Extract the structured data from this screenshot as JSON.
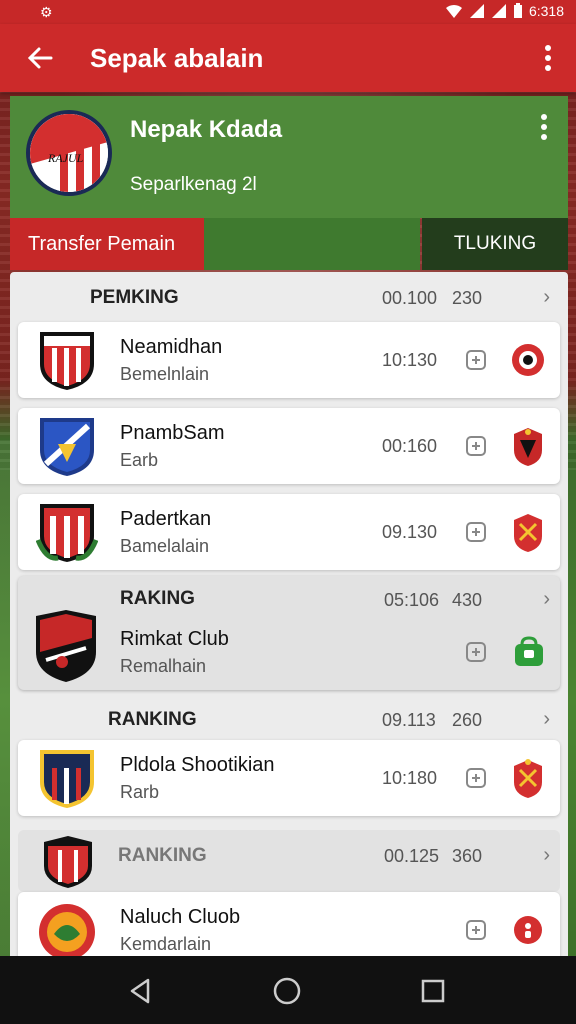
{
  "status_bar": {
    "left_icon": "gear-icon",
    "time": "6:318"
  },
  "app_bar": {
    "title": "Sepak abalain",
    "back_icon": "arrow-left-icon",
    "more_icon": "more-vertical-icon"
  },
  "team": {
    "name": "Nepak Kdada",
    "subtitle": "Separlkenag 2l",
    "logo_text": "RAJUL"
  },
  "tabs": {
    "transfer_label": "Transfer Pemain",
    "ranking_label": "TLUKING"
  },
  "sections": [
    {
      "header": {
        "label": "PEMKING",
        "time": "00.100",
        "score": "230"
      },
      "rows": [
        {
          "name": "Neamidhan",
          "sub": "Bemelnlain",
          "time": "10:130"
        },
        {
          "name": "PnambSam",
          "sub": "Earb",
          "time": "00:160"
        },
        {
          "name": "Padertkan",
          "sub": "Bamelalain",
          "time": "09.130"
        }
      ]
    },
    {
      "group": {
        "label": "RAKING",
        "time": "05:106",
        "score": "430",
        "name": "Rimkat Club",
        "sub": "Remalhain"
      }
    },
    {
      "header": {
        "label": "RANKING",
        "time": "09.113",
        "score": "260"
      },
      "rows": [
        {
          "name": "Pldola Shootikian",
          "sub": "Rarb",
          "time": "10:180"
        }
      ]
    },
    {
      "header": {
        "label": "RANKING",
        "time": "00.125",
        "score": "360"
      },
      "rows": [
        {
          "name": "Naluch Cluob",
          "sub": "Kemdarlain",
          "time": ""
        }
      ]
    }
  ],
  "colors": {
    "primary_red": "#cc2a2a",
    "team_green": "#4f8a3a",
    "dark_green": "#233d1c"
  },
  "nav": {
    "back_icon": "triangle-back-icon",
    "home_icon": "circle-home-icon",
    "recents_icon": "square-recents-icon"
  }
}
